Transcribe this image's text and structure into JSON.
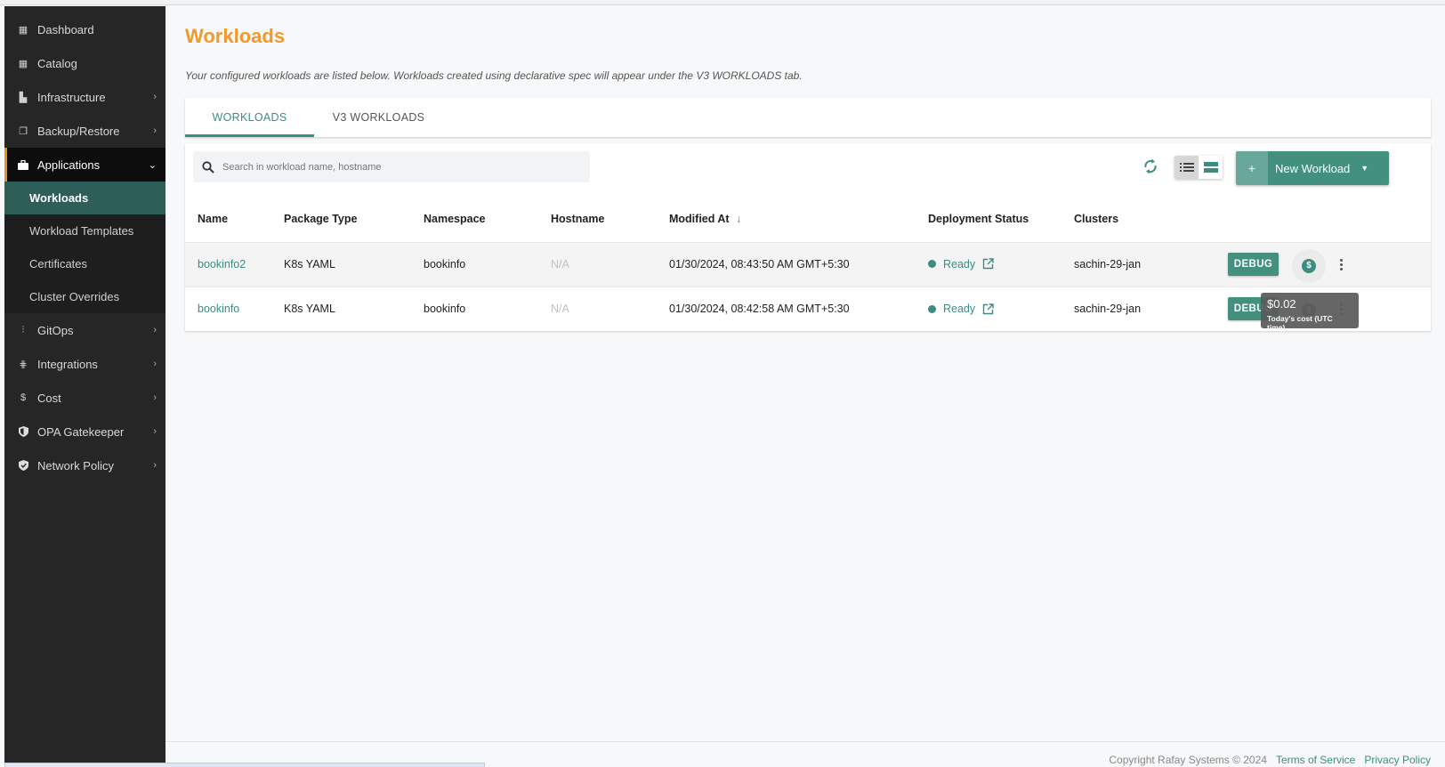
{
  "sidebar": {
    "items": [
      {
        "label": "Dashboard",
        "icon": "dashboard-icon",
        "has_children": false
      },
      {
        "label": "Catalog",
        "icon": "catalog-icon",
        "has_children": false
      },
      {
        "label": "Infrastructure",
        "icon": "infrastructure-icon",
        "has_children": true
      },
      {
        "label": "Backup/Restore",
        "icon": "backup-icon",
        "has_children": true
      },
      {
        "label": "Applications",
        "icon": "briefcase-icon",
        "has_children": true,
        "expanded": true
      },
      {
        "label": "GitOps",
        "icon": "gitops-icon",
        "has_children": true
      },
      {
        "label": "Integrations",
        "icon": "integrations-icon",
        "has_children": true
      },
      {
        "label": "Cost",
        "icon": "dollar-icon",
        "has_children": true
      },
      {
        "label": "OPA Gatekeeper",
        "icon": "shield-icon",
        "has_children": true
      },
      {
        "label": "Network Policy",
        "icon": "shield-check-icon",
        "has_children": true
      }
    ],
    "applications_children": [
      {
        "label": "Workloads",
        "active": true
      },
      {
        "label": "Workload Templates"
      },
      {
        "label": "Certificates"
      },
      {
        "label": "Cluster Overrides"
      }
    ]
  },
  "header": {
    "title": "Workloads",
    "description": "Your configured workloads are listed below. Workloads created using declarative spec will appear under the V3 WORKLOADS tab."
  },
  "tabs": [
    {
      "label": "WORKLOADS",
      "active": true
    },
    {
      "label": "V3 WORKLOADS",
      "active": false
    }
  ],
  "toolbar": {
    "search_placeholder": "Search in workload name, hostname",
    "search_value": "",
    "new_button_label": "New Workload",
    "new_button_plus": "+",
    "view_mode": "list"
  },
  "table": {
    "columns": [
      "Name",
      "Package Type",
      "Namespace",
      "Hostname",
      "Modified At",
      "Deployment Status",
      "Clusters"
    ],
    "sort_column": "Modified At",
    "sort_direction": "desc",
    "sort_icon": "↓",
    "rows": [
      {
        "name": "bookinfo2",
        "package_type": "K8s YAML",
        "namespace": "bookinfo",
        "hostname": "N/A",
        "modified_at": "01/30/2024, 08:43:50 AM GMT+5:30",
        "status": "Ready",
        "clusters": "sachin-29-jan",
        "debug_label": "DEBUG"
      },
      {
        "name": "bookinfo",
        "package_type": "K8s YAML",
        "namespace": "bookinfo",
        "hostname": "N/A",
        "modified_at": "01/30/2024, 08:42:58 AM GMT+5:30",
        "status": "Ready",
        "clusters": "sachin-29-jan",
        "debug_label": "DEBUG"
      }
    ]
  },
  "tooltip": {
    "amount": "$0.02",
    "caption": "Today's cost (UTC time)"
  },
  "colors": {
    "accent": "#3b8d82",
    "title": "#ef9a2e",
    "sidebar_bg": "#262626",
    "sidebar_active": "#2e5e58"
  },
  "footer": {
    "copyright": "Copyright Rafay Systems © 2024",
    "terms": "Terms of Service",
    "privacy": "Privacy Policy"
  }
}
